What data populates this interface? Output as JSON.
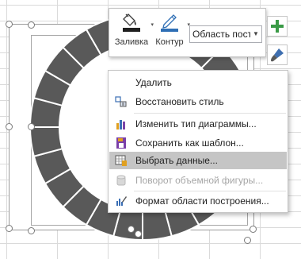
{
  "colors": {
    "ring_fill": "#595959",
    "ring_divider": "#ffffff",
    "menu_highlight": "#c5c5c5",
    "disabled_text": "#a6a6a6",
    "add_green": "#3a9a46"
  },
  "toolbar": {
    "fill_label": "Заливка",
    "fill_icon": "paint-bucket-icon",
    "outline_label": "Контур",
    "outline_icon": "pen-outline-icon",
    "element_selector_value": "Область постр"
  },
  "side_buttons": {
    "add_element_icon": "plus-icon",
    "styles_icon": "brush-icon"
  },
  "context_menu": {
    "items": [
      {
        "label": "Удалить",
        "icon": "none",
        "enabled": true
      },
      {
        "label": "Восстановить стиль",
        "icon": "reset-style-icon",
        "enabled": true
      },
      {
        "label": "Изменить тип диаграммы...",
        "icon": "bar-chart-icon",
        "enabled": true
      },
      {
        "label": "Сохранить как шаблон...",
        "icon": "save-template-icon",
        "enabled": true
      },
      {
        "label": "Выбрать данные...",
        "icon": "select-data-icon",
        "enabled": true,
        "highlighted": true
      },
      {
        "label": "Поворот объемной фигуры...",
        "icon": "rotate-3d-icon",
        "enabled": false
      },
      {
        "label": "Формат области построения...",
        "icon": "format-area-icon",
        "enabled": true
      }
    ]
  },
  "chart_data": {
    "type": "doughnut",
    "title": "",
    "segments": 24,
    "values": [
      1,
      1,
      1,
      1,
      1,
      1,
      1,
      1,
      1,
      1,
      1,
      1,
      1,
      1,
      1,
      1,
      1,
      1,
      1,
      1,
      1,
      1,
      1,
      1
    ]
  }
}
